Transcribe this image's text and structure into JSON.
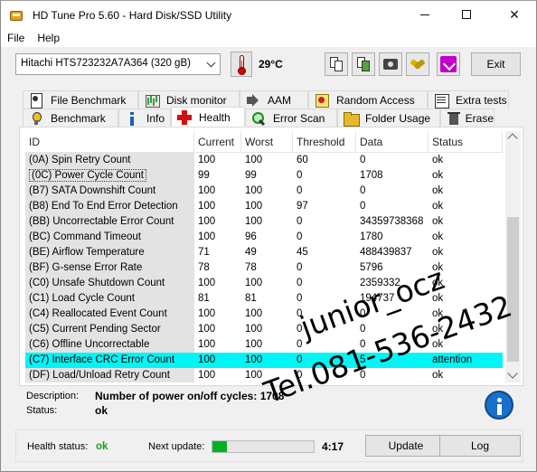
{
  "window": {
    "title": "HD Tune Pro 5.60 - Hard Disk/SSD Utility"
  },
  "menu": [
    "File",
    "Help"
  ],
  "toolbar": {
    "drive": "Hitachi HTS723232A7A364 (320 gB)",
    "temperature": "29°C",
    "exit_label": "Exit",
    "icons": [
      "copy-text-icon",
      "copy-info-icon",
      "screenshot-icon",
      "options-icon",
      "save-icon"
    ]
  },
  "tabs": {
    "row1": [
      "File Benchmark",
      "Disk monitor",
      "AAM",
      "Random Access",
      "Extra tests"
    ],
    "row2": [
      "Benchmark",
      "Info",
      "Health",
      "Error Scan",
      "Folder Usage",
      "Erase"
    ],
    "active": "Health"
  },
  "health_table": {
    "columns": [
      "ID",
      "Current",
      "Worst",
      "Threshold",
      "Data",
      "Status"
    ],
    "rows": [
      [
        "(0A) Spin Retry Count",
        "100",
        "100",
        "60",
        "0",
        "ok"
      ],
      [
        "(0C) Power Cycle Count",
        "99",
        "99",
        "0",
        "1708",
        "ok"
      ],
      [
        "(B7) SATA Downshift Count",
        "100",
        "100",
        "0",
        "0",
        "ok"
      ],
      [
        "(B8) End To End Error Detection",
        "100",
        "100",
        "97",
        "0",
        "ok"
      ],
      [
        "(BB) Uncorrectable Error Count",
        "100",
        "100",
        "0",
        "34359738368",
        "ok"
      ],
      [
        "(BC) Command Timeout",
        "100",
        "96",
        "0",
        "1780",
        "ok"
      ],
      [
        "(BE) Airflow Temperature",
        "71",
        "49",
        "45",
        "488439837",
        "ok"
      ],
      [
        "(BF) G-sense Error Rate",
        "78",
        "78",
        "0",
        "5796",
        "ok"
      ],
      [
        "(C0) Unsafe Shutdown Count",
        "100",
        "100",
        "0",
        "2359332",
        "ok"
      ],
      [
        "(C1) Load Cycle Count",
        "81",
        "81",
        "0",
        "194737",
        "ok"
      ],
      [
        "(C4) Reallocated Event Count",
        "100",
        "100",
        "0",
        "0",
        "ok"
      ],
      [
        "(C5) Current Pending Sector",
        "100",
        "100",
        "0",
        "0",
        "ok"
      ],
      [
        "(C6) Offline Uncorrectable",
        "100",
        "100",
        "0",
        "0",
        "ok"
      ],
      [
        "(C7) Interface CRC Error Count",
        "100",
        "100",
        "0",
        "5",
        "attention"
      ],
      [
        "(DF) Load/Unload Retry Count",
        "100",
        "100",
        "0",
        "0",
        "ok"
      ]
    ],
    "selected_row": 1,
    "highlighted_row": 13
  },
  "details": {
    "description_label": "Description:",
    "description_value": "Number of power on/off cycles: 1708",
    "status_label": "Status:",
    "status_value": "ok"
  },
  "footer": {
    "health_label": "Health status:",
    "health_value": "ok",
    "next_update_label": "Next update:",
    "next_update_progress": 0.14,
    "next_update_time": "4:17",
    "update_label": "Update",
    "log_label": "Log"
  },
  "watermark": {
    "line1": "junior_ocz",
    "line2": "Tel.081-536-2432"
  },
  "colors": {
    "highlight_row": "#00f5f5",
    "health_ok": "#1a9a1a",
    "progress_fill": "#06b025"
  }
}
